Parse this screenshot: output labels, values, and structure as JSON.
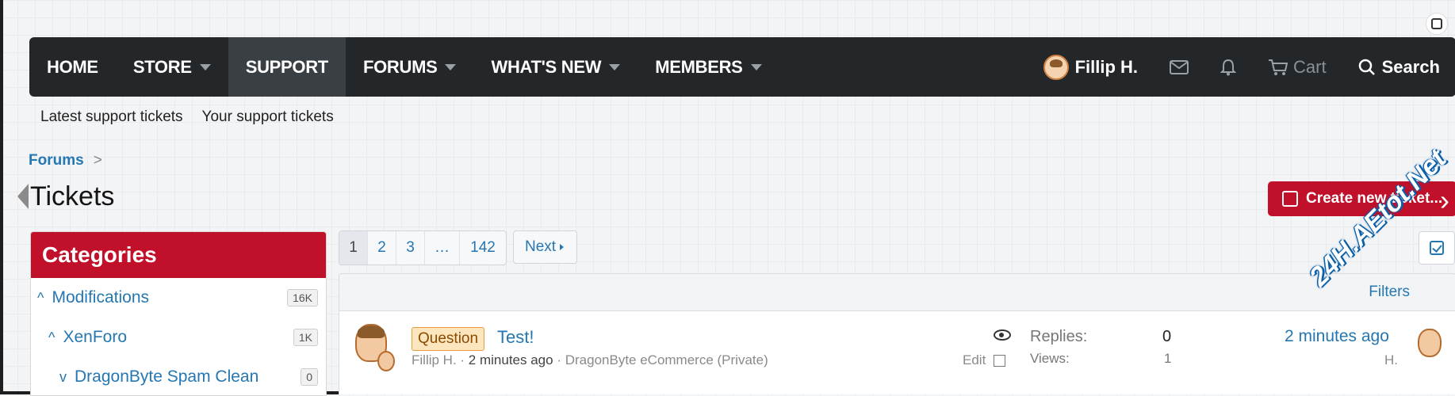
{
  "nav": {
    "items": [
      {
        "label": "HOME",
        "caret": false,
        "active": false
      },
      {
        "label": "STORE",
        "caret": true,
        "active": false
      },
      {
        "label": "SUPPORT",
        "caret": false,
        "active": true
      },
      {
        "label": "FORUMS",
        "caret": true,
        "active": false
      },
      {
        "label": "WHAT'S NEW",
        "caret": true,
        "active": false
      },
      {
        "label": "MEMBERS",
        "caret": true,
        "active": false
      }
    ],
    "user_name": "Fillip H.",
    "cart_label": "Cart",
    "search_label": "Search"
  },
  "subnav": {
    "latest": "Latest support tickets",
    "yours": "Your support tickets"
  },
  "breadcrumb": {
    "forums": "Forums",
    "separator": ">"
  },
  "page": {
    "title": "Tickets",
    "create_label": "Create new ticket..."
  },
  "categories": {
    "heading": "Categories",
    "items": [
      {
        "label": "Modifications",
        "count": "16K",
        "chevron": "^"
      },
      {
        "label": "XenForo",
        "count": "1K",
        "chevron": "^"
      },
      {
        "label": "DragonByte Spam Clean",
        "count": "0",
        "chevron": "v"
      }
    ]
  },
  "pagination": {
    "pages": [
      "1",
      "2",
      "3",
      "…",
      "142"
    ],
    "current": "1",
    "next_label": "Next"
  },
  "filters": {
    "label": "Filters"
  },
  "ticket": {
    "prefix": "Question",
    "title": "Test!",
    "author": "Fillip H.",
    "time": "2 minutes ago",
    "category": "DragonByte eCommerce (Private)",
    "edit_label": "Edit",
    "replies_label": "Replies:",
    "replies": "0",
    "views_label": "Views:",
    "views": "1",
    "last_time": "2 minutes ago",
    "last_user": "H."
  },
  "watermark": "24H.AEtot.Net",
  "colors": {
    "brand": "#c0102a",
    "link": "#2577b1",
    "nav_bg": "#23272a"
  }
}
